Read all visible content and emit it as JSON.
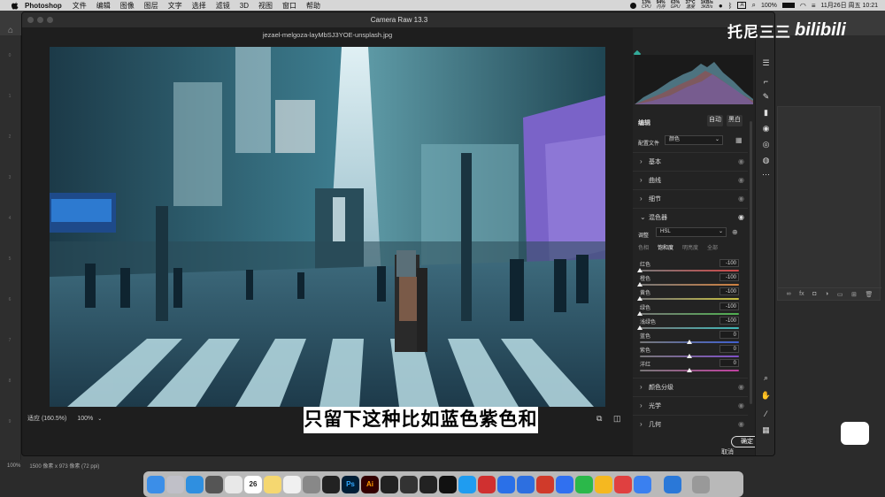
{
  "menubar": {
    "app": "Photoshop",
    "items": [
      "文件",
      "编辑",
      "图像",
      "图层",
      "文字",
      "选择",
      "滤镜",
      "3D",
      "视图",
      "窗口",
      "帮助"
    ],
    "stats": [
      {
        "top": "13%",
        "bottom": "CPU"
      },
      {
        "top": "94%",
        "bottom": "内存"
      },
      {
        "top": "63%",
        "bottom": "GPU"
      },
      {
        "top": "37°C",
        "bottom": "温度"
      },
      {
        "top": "1KB/s",
        "bottom": "3KB/s"
      }
    ],
    "input_method": "A",
    "battery": "100%",
    "clock": "11月26日 周五  10:21"
  },
  "dialog": {
    "title": "Camera Raw 13.3",
    "filename": "jezael-melgoza-layMbSJ3YOE-unsplash.jpg",
    "zoom_fit": "适应 (160.5%)",
    "zoom_pct": "100%"
  },
  "panel": {
    "edit_label": "编辑",
    "auto_button": "自动",
    "bw_button": "黑白",
    "profile_label": "配置文件",
    "profile_value": "颜色",
    "sections_top": [
      "基本",
      "曲线",
      "细节"
    ],
    "mixer_title": "混色器",
    "adjust_label": "调整",
    "adjust_value": "HSL",
    "tabs": [
      "色相",
      "饱和度",
      "明亮度",
      "全部"
    ],
    "active_tab": 1,
    "sliders": [
      {
        "label": "红色",
        "value": "-100",
        "color": "#d04848",
        "pos": 0
      },
      {
        "label": "橙色",
        "value": "-100",
        "color": "#d08040",
        "pos": 0
      },
      {
        "label": "黄色",
        "value": "-100",
        "color": "#c8c040",
        "pos": 0
      },
      {
        "label": "绿色",
        "value": "-100",
        "color": "#50b050",
        "pos": 0
      },
      {
        "label": "浅绿色",
        "value": "-100",
        "color": "#40b8b8",
        "pos": 0
      },
      {
        "label": "蓝色",
        "value": "0",
        "color": "#4060d0",
        "pos": 0.5
      },
      {
        "label": "紫色",
        "value": "0",
        "color": "#8050c8",
        "pos": 0.5
      },
      {
        "label": "洋红",
        "value": "0",
        "color": "#c040a0",
        "pos": 0.5
      }
    ],
    "sections_bottom": [
      "颜色分级",
      "光学",
      "几何"
    ],
    "cancel_button": "取消",
    "ok_button": "确定"
  },
  "subtitle": "只留下这种比如蓝色紫色和",
  "status": {
    "zoom": "100%",
    "dims": "1500 像素 x 973 像素 (72 ppi)"
  },
  "watermark": {
    "text": "托尼三三",
    "brand": "bilibili"
  },
  "left_ticks": [
    "0",
    "1",
    "2",
    "3",
    "4",
    "5",
    "6",
    "7",
    "8",
    "9"
  ],
  "dock_icons": [
    "finder-icon",
    "launchpad-icon",
    "safari-icon",
    "screenshot-icon",
    "chrome-icon",
    "calendar-icon",
    "notes-icon",
    "reminders-icon",
    "settings-icon",
    "pen-icon",
    "photoshop-icon",
    "illustrator-icon",
    "final-cut-icon",
    "camera-icon",
    "obs-icon",
    "capcut-icon",
    "qq-icon",
    "netease-icon",
    "feishu-icon",
    "baidu-icon",
    "office-icon",
    "wps-icon",
    "wechat-icon",
    "qq-music-icon",
    "weibo-icon",
    "tencent-meeting-icon",
    "preview-icon",
    "trash-icon"
  ],
  "calendar_day": "26",
  "ps_label": "Ps",
  "ai_label": "Ai"
}
